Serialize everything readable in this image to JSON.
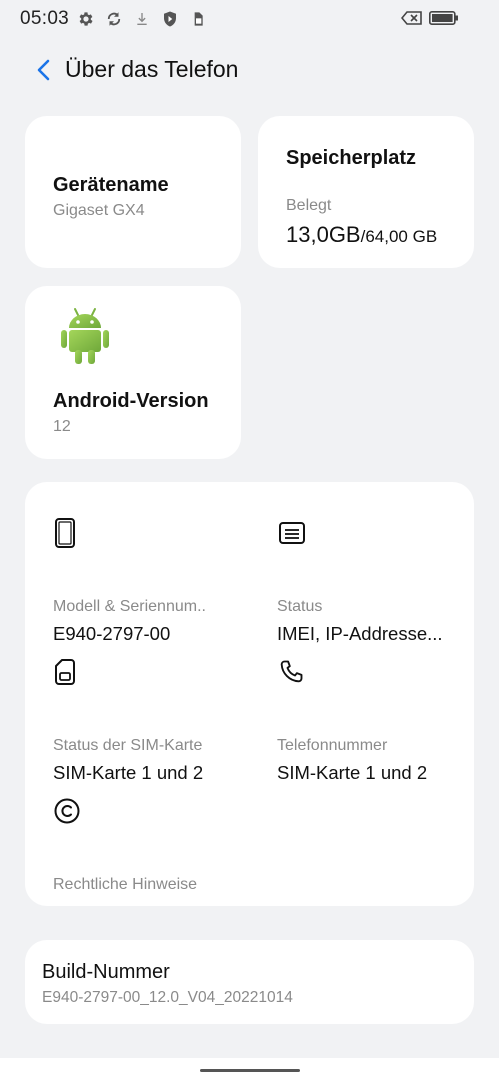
{
  "statusbar": {
    "time": "05:03",
    "icons": [
      "gear-icon",
      "sync-icon",
      "download-icon",
      "shield-icon",
      "sim-icon"
    ],
    "right_icons": [
      "no-signal-icon",
      "battery-icon"
    ]
  },
  "header": {
    "title": "Über das Telefon"
  },
  "device_card": {
    "title": "Gerätename",
    "value": "Gigaset GX4"
  },
  "storage_card": {
    "title": "Speicherplatz",
    "label": "Belegt",
    "used": "13,0GB",
    "total": "/64,00 GB"
  },
  "android_card": {
    "title": "Android-Version",
    "value": "12",
    "accent": "#8bc34a"
  },
  "info_grid": {
    "items": [
      {
        "icon": "phone-outline-icon",
        "label": "Modell & Seriennum..",
        "value": "E940-2797-00"
      },
      {
        "icon": "status-card-icon",
        "label": "Status",
        "value": "IMEI, IP-Addresse..."
      },
      {
        "icon": "sim-card-icon",
        "label": "Status der SIM-Karte",
        "value": "SIM-Karte 1 und 2"
      },
      {
        "icon": "phone-call-icon",
        "label": "Telefonnummer",
        "value": "SIM-Karte 1 und 2"
      },
      {
        "icon": "copyright-icon",
        "label": "Rechtliche Hinweise",
        "value": ""
      }
    ]
  },
  "build_card": {
    "title": "Build-Nummer",
    "value": "E940-2797-00_12.0_V04_20221014"
  },
  "colors": {
    "accent_blue": "#1a73e8",
    "background": "#f1f2f4",
    "card": "#ffffff",
    "secondary_text": "#8a8a8a"
  }
}
